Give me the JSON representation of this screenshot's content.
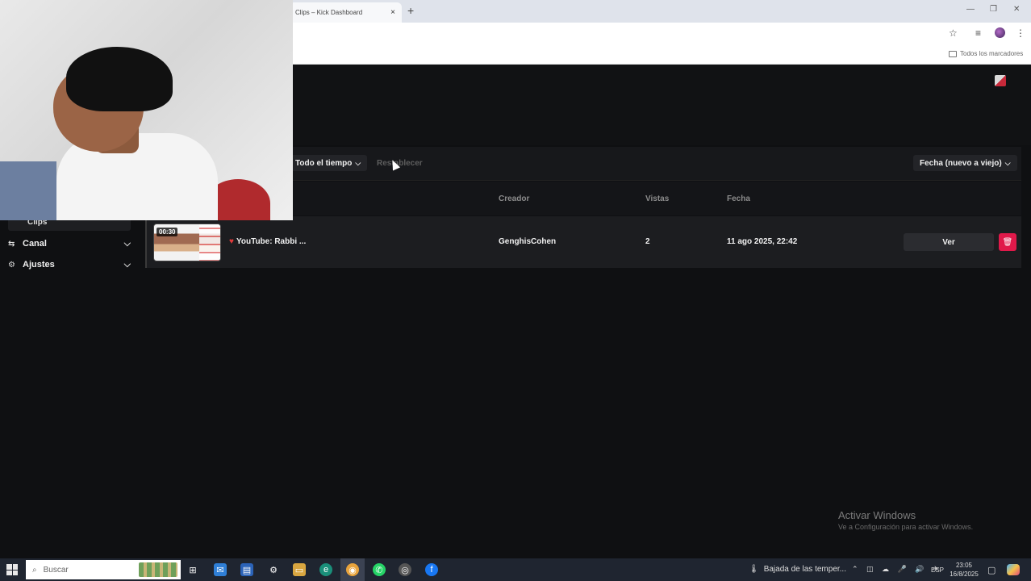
{
  "browser": {
    "tab_title": "Clips – Kick Dashboard",
    "tab_close": "×",
    "new_tab": "+",
    "bookmarks_all": "Todos los marcadores"
  },
  "filters": {
    "time_range": "Todo el tiempo",
    "reset": "Restablecer",
    "sort": "Fecha (nuevo a viejo)"
  },
  "table": {
    "columns": [
      "Creador",
      "Vistas",
      "Fecha"
    ],
    "rows": [
      {
        "duration": "00:30",
        "title": "YouTube: Rabbi ...",
        "creator": "GenghisCohen",
        "views": "2",
        "date": "11 ago 2025, 22:42",
        "action": "Ver"
      }
    ]
  },
  "sidebar": {
    "items": [
      {
        "label": "Clips",
        "icon": "clips-icon"
      },
      {
        "label": "Canal",
        "icon": "channel-icon"
      },
      {
        "label": "Ajustes",
        "icon": "gear-icon"
      }
    ]
  },
  "watermark": {
    "title": "Activar Windows",
    "subtitle": "Ve a Configuración para activar Windows."
  },
  "taskbar": {
    "search_placeholder": "Buscar",
    "weather_text": "Bajada de las temper...",
    "language": "ESP",
    "time": "23:05",
    "date": "16/8/2025"
  },
  "colors": {
    "background": "#0f1012",
    "row": "#1c1d20",
    "delete_button": "#e0194a"
  }
}
